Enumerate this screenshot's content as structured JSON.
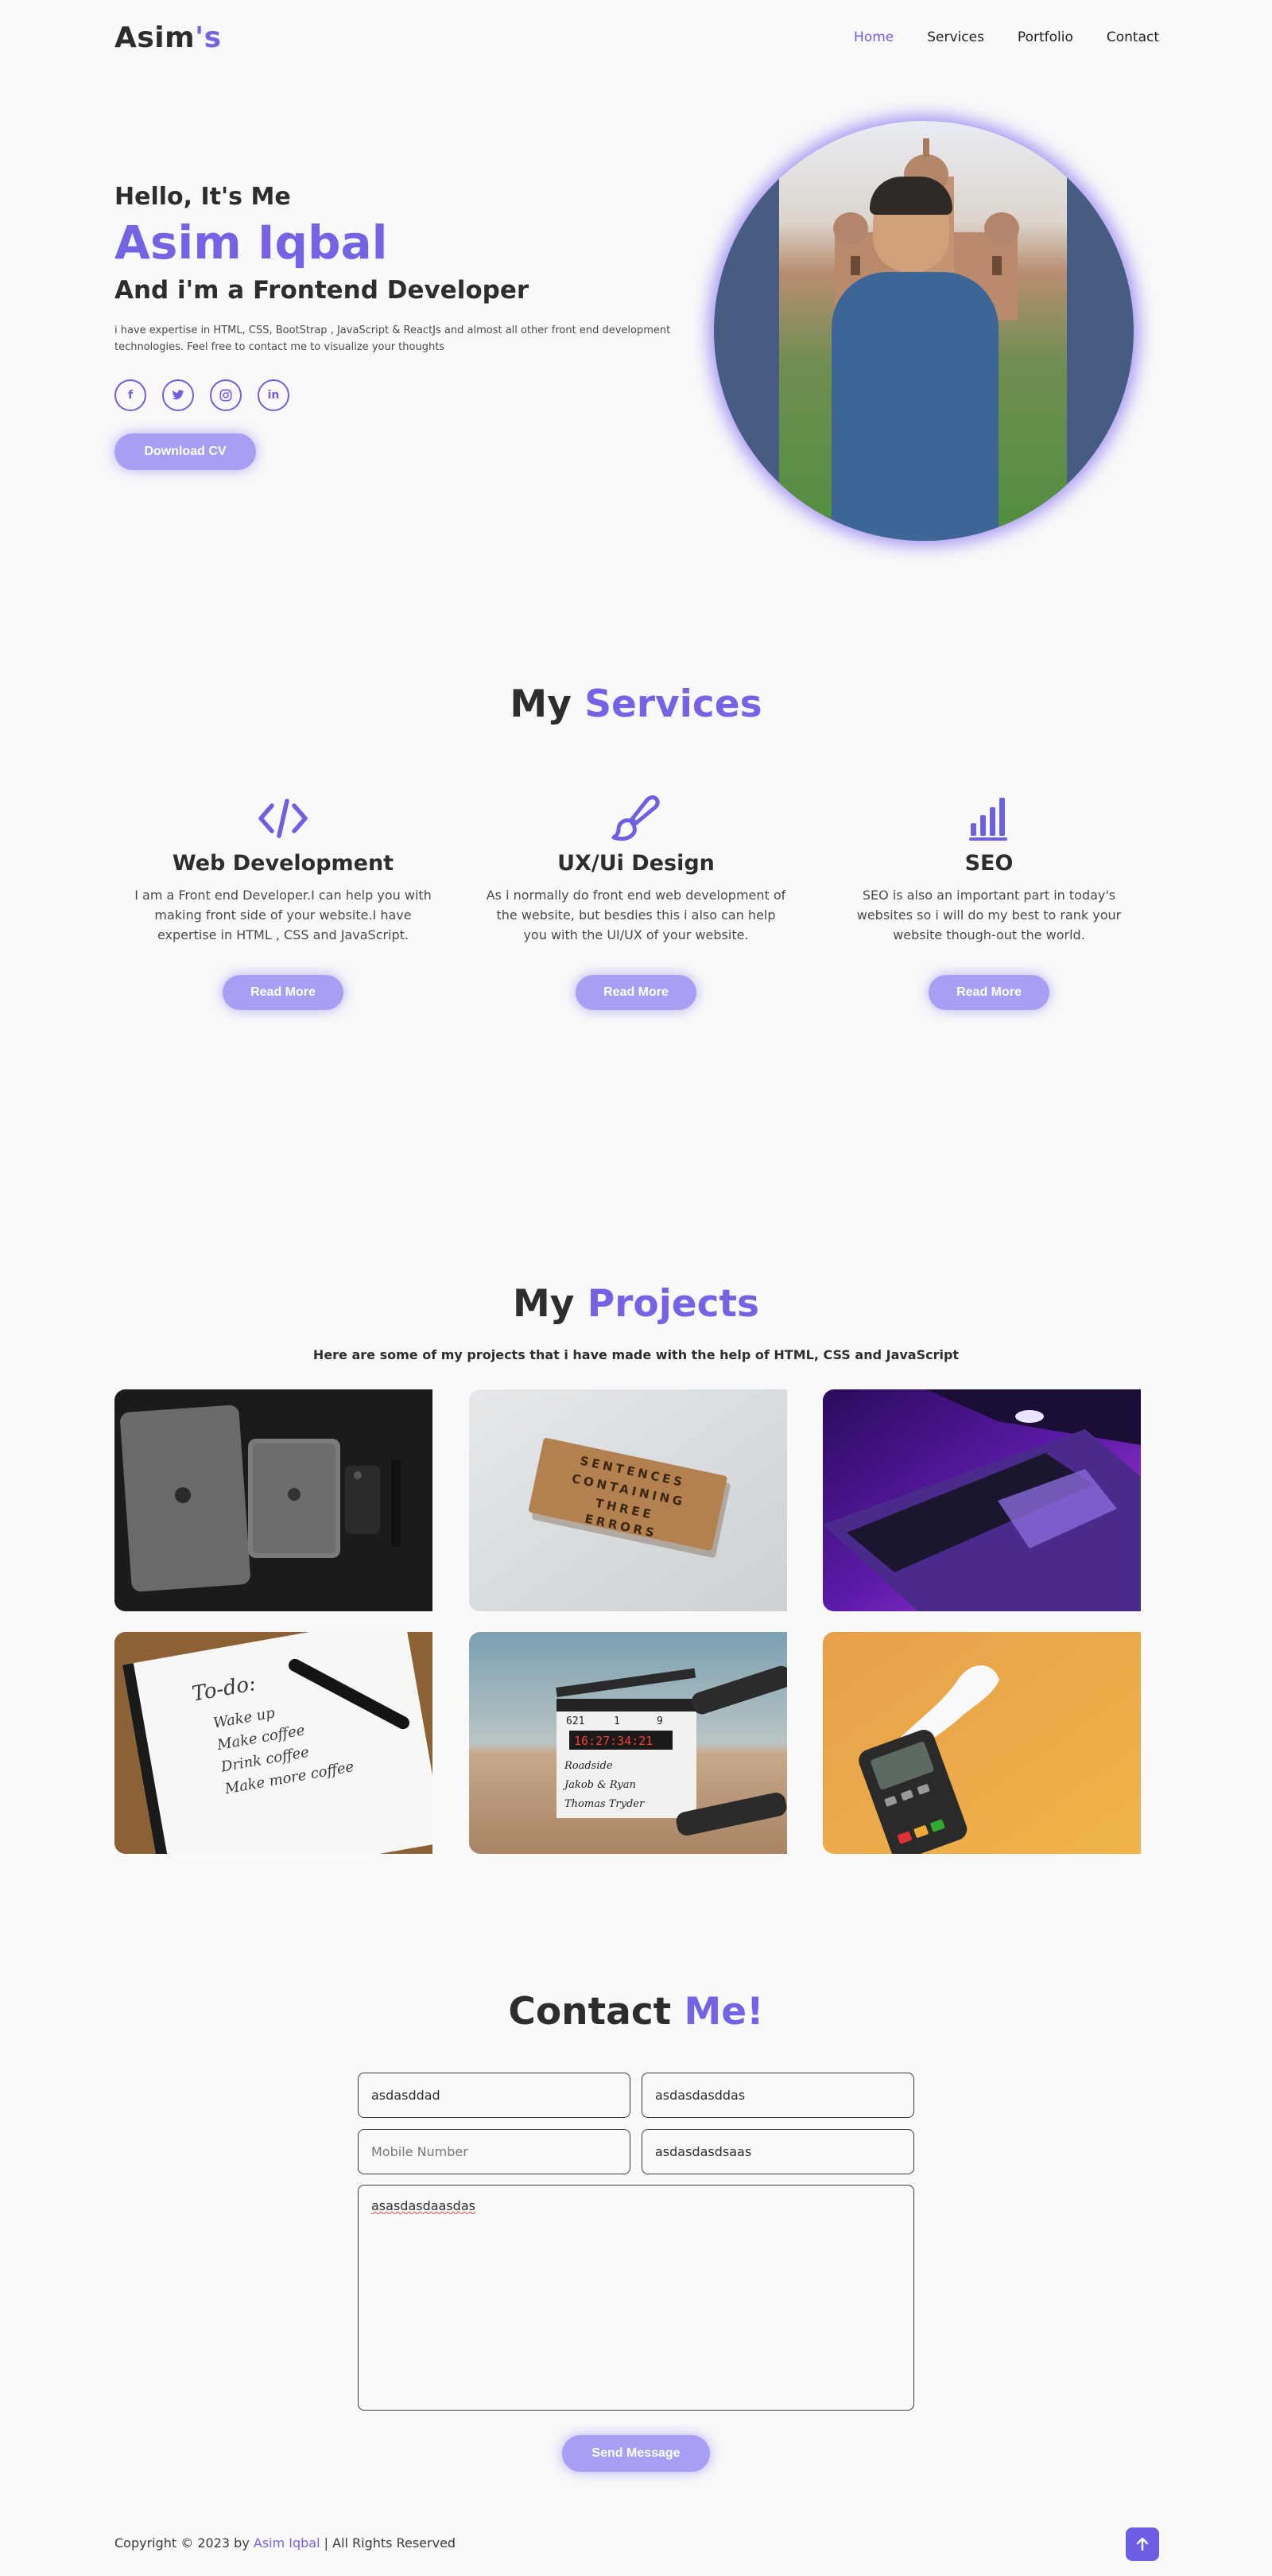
{
  "nav": {
    "logo_main": "Asim",
    "logo_accent": "'s",
    "links": [
      "Home",
      "Services",
      "Portfolio",
      "Contact"
    ]
  },
  "hero": {
    "greeting": "Hello, It's Me",
    "name": "Asim Iqbal",
    "role": "And i'm a Frontend Developer",
    "intro": "i have expertise in HTML, CSS, BootStrap , JavaScript & ReactJs and almost all other front end development technologies. Feel free to contact me to visualize your thoughts",
    "socials": [
      "facebook-icon",
      "twitter-icon",
      "instagram-icon",
      "linkedin-icon"
    ],
    "cv_button": "Download CV"
  },
  "services": {
    "title_main": "My ",
    "title_accent": "Services",
    "items": [
      {
        "icon": "code-icon",
        "title": "Web Development",
        "desc": "I am a Front end Developer.I can help you with making front side of your website.I have expertise in HTML , CSS and JavaScript.",
        "button": "Read More"
      },
      {
        "icon": "paintbrush-icon",
        "title": "UX/Ui Design",
        "desc": "As i normally do front end web development of the website, but besdies this i also can help you with the UI/UX of your website.",
        "button": "Read More"
      },
      {
        "icon": "signal-bars-icon",
        "title": "SEO",
        "desc": "SEO is also an important part in today's websites so i will do my best to rank your website though-out the world.",
        "button": "Read More"
      }
    ]
  },
  "projects": {
    "title_main": "My ",
    "title_accent": "Projects",
    "subtitle": "Here are some of my projects that i have made with the help of HTML, CSS and JavaScript",
    "images": [
      "apple-devices-image",
      "scrabble-tiles-image",
      "laptop-purple-image",
      "todo-notebook-image",
      "film-clapperboard-image",
      "card-machine-image"
    ],
    "tile_words": [
      "SENTENCES",
      "CONTAINING",
      "THREE",
      "ERRORS"
    ],
    "todo_lines": [
      "To-do:",
      "Wake up",
      "Make coffee",
      "Drink coffee",
      "Make more coffee"
    ],
    "clapper_text": [
      "621",
      "1",
      "9",
      "16:27:34:21",
      "Roadside",
      "Jakob & Ryan",
      "Thomas Tryder"
    ]
  },
  "contact": {
    "title_main": "Contact ",
    "title_accent": "Me!",
    "fields": [
      {
        "value": "asdasddad",
        "placeholder": ""
      },
      {
        "value": "asdasdasddas",
        "placeholder": ""
      },
      {
        "value": "",
        "placeholder": "Mobile Number"
      },
      {
        "value": "asdasdasdsaas",
        "placeholder": ""
      }
    ],
    "message": "asasdasdaasdas",
    "send_button": "Send Message"
  },
  "footer": {
    "copyright_prefix": "Copyright © 2023 by ",
    "copyright_name": "Asim Iqbal",
    "copyright_suffix": " | All Rights Reserved",
    "top_icon": "arrow-up-icon"
  },
  "colors": {
    "accent": "#7563e6",
    "button": "#a89ff4",
    "text": "#2d2d2d",
    "background": "#f9f9f9"
  }
}
